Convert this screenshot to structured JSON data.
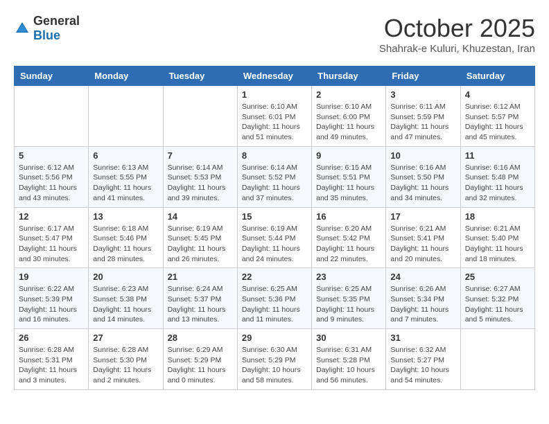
{
  "header": {
    "logo_general": "General",
    "logo_blue": "Blue",
    "month_title": "October 2025",
    "subtitle": "Shahrak-e Kuluri, Khuzestan, Iran"
  },
  "days_of_week": [
    "Sunday",
    "Monday",
    "Tuesday",
    "Wednesday",
    "Thursday",
    "Friday",
    "Saturday"
  ],
  "weeks": [
    [
      {
        "day": "",
        "info": ""
      },
      {
        "day": "",
        "info": ""
      },
      {
        "day": "",
        "info": ""
      },
      {
        "day": "1",
        "info": "Sunrise: 6:10 AM\nSunset: 6:01 PM\nDaylight: 11 hours and 51 minutes."
      },
      {
        "day": "2",
        "info": "Sunrise: 6:10 AM\nSunset: 6:00 PM\nDaylight: 11 hours and 49 minutes."
      },
      {
        "day": "3",
        "info": "Sunrise: 6:11 AM\nSunset: 5:59 PM\nDaylight: 11 hours and 47 minutes."
      },
      {
        "day": "4",
        "info": "Sunrise: 6:12 AM\nSunset: 5:57 PM\nDaylight: 11 hours and 45 minutes."
      }
    ],
    [
      {
        "day": "5",
        "info": "Sunrise: 6:12 AM\nSunset: 5:56 PM\nDaylight: 11 hours and 43 minutes."
      },
      {
        "day": "6",
        "info": "Sunrise: 6:13 AM\nSunset: 5:55 PM\nDaylight: 11 hours and 41 minutes."
      },
      {
        "day": "7",
        "info": "Sunrise: 6:14 AM\nSunset: 5:53 PM\nDaylight: 11 hours and 39 minutes."
      },
      {
        "day": "8",
        "info": "Sunrise: 6:14 AM\nSunset: 5:52 PM\nDaylight: 11 hours and 37 minutes."
      },
      {
        "day": "9",
        "info": "Sunrise: 6:15 AM\nSunset: 5:51 PM\nDaylight: 11 hours and 35 minutes."
      },
      {
        "day": "10",
        "info": "Sunrise: 6:16 AM\nSunset: 5:50 PM\nDaylight: 11 hours and 34 minutes."
      },
      {
        "day": "11",
        "info": "Sunrise: 6:16 AM\nSunset: 5:48 PM\nDaylight: 11 hours and 32 minutes."
      }
    ],
    [
      {
        "day": "12",
        "info": "Sunrise: 6:17 AM\nSunset: 5:47 PM\nDaylight: 11 hours and 30 minutes."
      },
      {
        "day": "13",
        "info": "Sunrise: 6:18 AM\nSunset: 5:46 PM\nDaylight: 11 hours and 28 minutes."
      },
      {
        "day": "14",
        "info": "Sunrise: 6:19 AM\nSunset: 5:45 PM\nDaylight: 11 hours and 26 minutes."
      },
      {
        "day": "15",
        "info": "Sunrise: 6:19 AM\nSunset: 5:44 PM\nDaylight: 11 hours and 24 minutes."
      },
      {
        "day": "16",
        "info": "Sunrise: 6:20 AM\nSunset: 5:42 PM\nDaylight: 11 hours and 22 minutes."
      },
      {
        "day": "17",
        "info": "Sunrise: 6:21 AM\nSunset: 5:41 PM\nDaylight: 11 hours and 20 minutes."
      },
      {
        "day": "18",
        "info": "Sunrise: 6:21 AM\nSunset: 5:40 PM\nDaylight: 11 hours and 18 minutes."
      }
    ],
    [
      {
        "day": "19",
        "info": "Sunrise: 6:22 AM\nSunset: 5:39 PM\nDaylight: 11 hours and 16 minutes."
      },
      {
        "day": "20",
        "info": "Sunrise: 6:23 AM\nSunset: 5:38 PM\nDaylight: 11 hours and 14 minutes."
      },
      {
        "day": "21",
        "info": "Sunrise: 6:24 AM\nSunset: 5:37 PM\nDaylight: 11 hours and 13 minutes."
      },
      {
        "day": "22",
        "info": "Sunrise: 6:25 AM\nSunset: 5:36 PM\nDaylight: 11 hours and 11 minutes."
      },
      {
        "day": "23",
        "info": "Sunrise: 6:25 AM\nSunset: 5:35 PM\nDaylight: 11 hours and 9 minutes."
      },
      {
        "day": "24",
        "info": "Sunrise: 6:26 AM\nSunset: 5:34 PM\nDaylight: 11 hours and 7 minutes."
      },
      {
        "day": "25",
        "info": "Sunrise: 6:27 AM\nSunset: 5:32 PM\nDaylight: 11 hours and 5 minutes."
      }
    ],
    [
      {
        "day": "26",
        "info": "Sunrise: 6:28 AM\nSunset: 5:31 PM\nDaylight: 11 hours and 3 minutes."
      },
      {
        "day": "27",
        "info": "Sunrise: 6:28 AM\nSunset: 5:30 PM\nDaylight: 11 hours and 2 minutes."
      },
      {
        "day": "28",
        "info": "Sunrise: 6:29 AM\nSunset: 5:29 PM\nDaylight: 11 hours and 0 minutes."
      },
      {
        "day": "29",
        "info": "Sunrise: 6:30 AM\nSunset: 5:29 PM\nDaylight: 10 hours and 58 minutes."
      },
      {
        "day": "30",
        "info": "Sunrise: 6:31 AM\nSunset: 5:28 PM\nDaylight: 10 hours and 56 minutes."
      },
      {
        "day": "31",
        "info": "Sunrise: 6:32 AM\nSunset: 5:27 PM\nDaylight: 10 hours and 54 minutes."
      },
      {
        "day": "",
        "info": ""
      }
    ]
  ]
}
